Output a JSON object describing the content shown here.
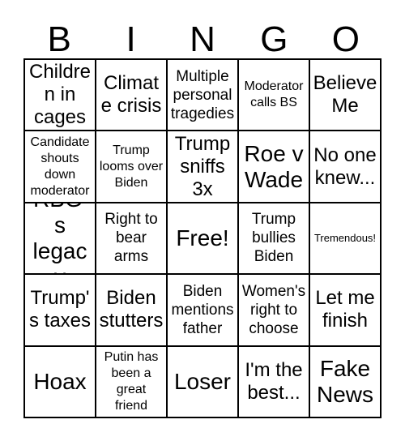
{
  "header": {
    "letters": [
      "B",
      "I",
      "N",
      "G",
      "O"
    ]
  },
  "grid": {
    "rows": 5,
    "columns": 5,
    "border_color": "#000000",
    "background_color": "#ffffff",
    "text_color": "#000000",
    "cells": [
      {
        "text": "Children in cages",
        "size": "fs-lg"
      },
      {
        "text": "Climate crisis",
        "size": "fs-lg"
      },
      {
        "text": "Multiple personal tragedies",
        "size": "fs-md"
      },
      {
        "text": "Moderator calls BS",
        "size": "fs-sm"
      },
      {
        "text": "Believe Me",
        "size": "fs-lg"
      },
      {
        "text": "Candidate shouts down moderator",
        "size": "fs-sm"
      },
      {
        "text": "Trump looms over Biden",
        "size": "fs-sm"
      },
      {
        "text": "Trump sniffs 3x",
        "size": "fs-lg"
      },
      {
        "text": "Roe v Wade",
        "size": "fs-xl"
      },
      {
        "text": "No one knew...",
        "size": "fs-lg"
      },
      {
        "text": "RBG's legacy",
        "size": "fs-xl"
      },
      {
        "text": "Right to bear arms",
        "size": "fs-md"
      },
      {
        "text": "Free!",
        "size": "fs-xl"
      },
      {
        "text": "Trump bullies Biden",
        "size": "fs-md"
      },
      {
        "text": "Tremendous!",
        "size": "fs-xs"
      },
      {
        "text": "Trump's taxes",
        "size": "fs-lg"
      },
      {
        "text": "Biden stutters",
        "size": "fs-lg"
      },
      {
        "text": "Biden mentions father",
        "size": "fs-md"
      },
      {
        "text": "Women's right to choose",
        "size": "fs-md"
      },
      {
        "text": "Let me finish",
        "size": "fs-lg"
      },
      {
        "text": "Hoax",
        "size": "fs-xl"
      },
      {
        "text": "Putin has been a great friend",
        "size": "fs-sm"
      },
      {
        "text": "Loser",
        "size": "fs-xl"
      },
      {
        "text": "I'm the best...",
        "size": "fs-lg"
      },
      {
        "text": "Fake News",
        "size": "fs-xl"
      }
    ]
  }
}
